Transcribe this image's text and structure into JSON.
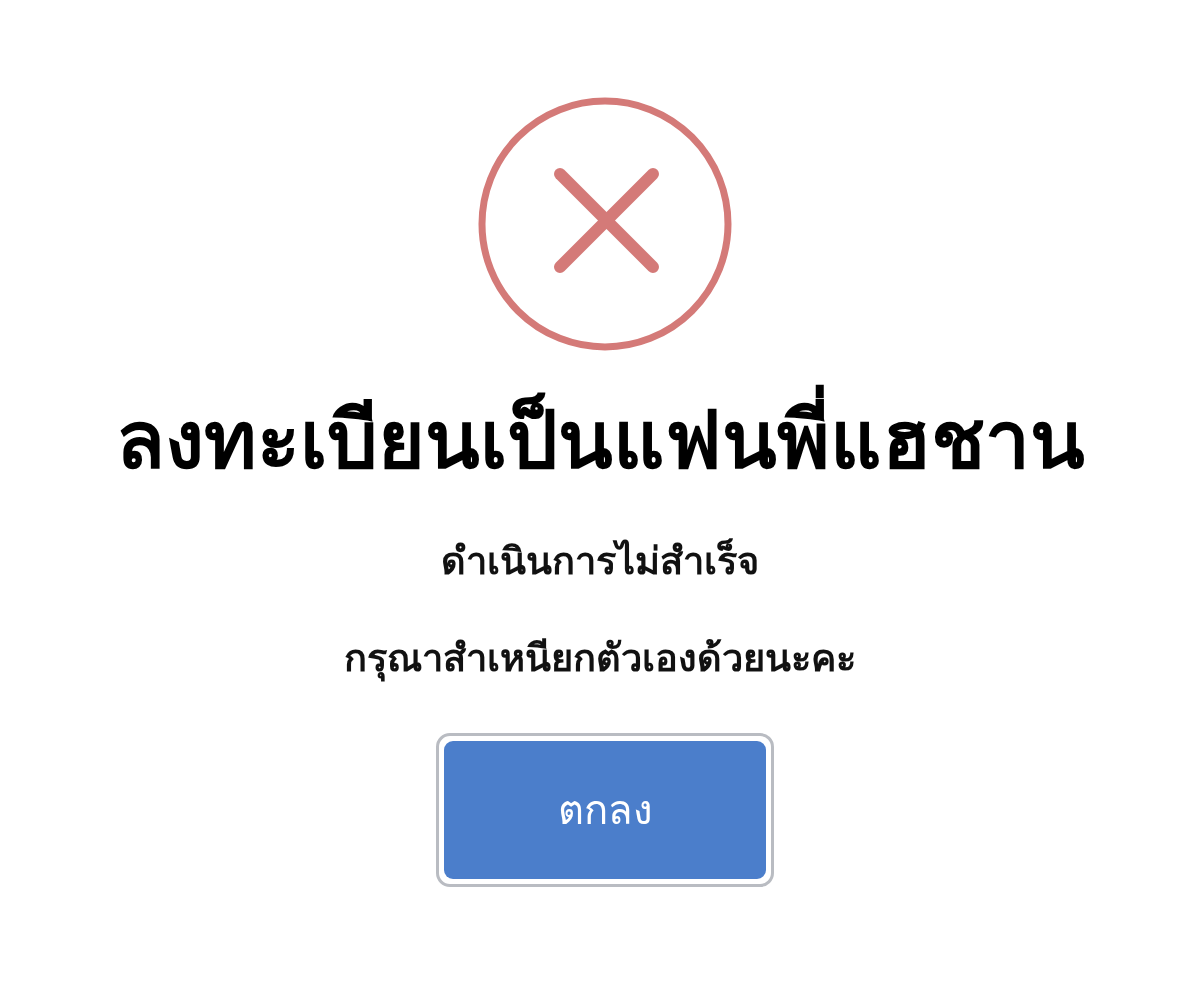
{
  "dialog": {
    "title": "ลงทะเบียนเป็นแฟนพี่แฮชาน",
    "messages": [
      "ดำเนินการไม่สำเร็จ",
      "กรุณาสำเหนียกตัวเองด้วยนะคะ"
    ],
    "buttons": [
      {
        "label": "ตกลง"
      }
    ]
  }
}
